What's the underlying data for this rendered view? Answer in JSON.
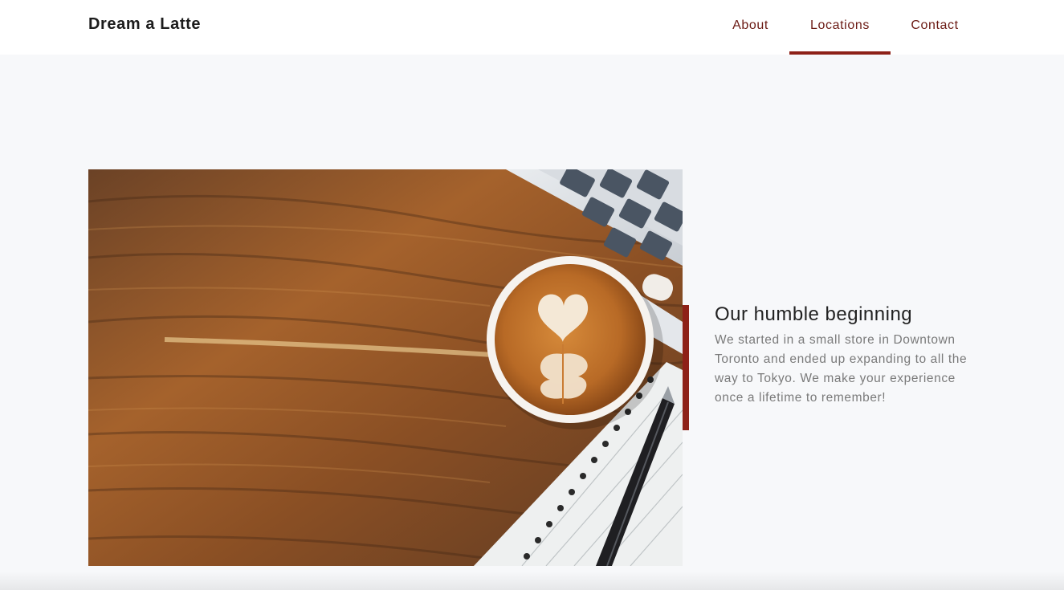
{
  "navbar": {
    "brand": "Dream a Latte",
    "links": [
      {
        "label": "About",
        "active": false
      },
      {
        "label": "Locations",
        "active": true
      },
      {
        "label": "Contact",
        "active": false
      }
    ]
  },
  "main": {
    "image_subject": "latte-art-coffee-on-wooden-desk-with-laptop-and-notebook",
    "heading": "Our humble beginning",
    "paragraph": "We started in a small store in Downtown Toronto and ended up expanding to all the way to Tokyo. We make your experience once a lifetime to remember!"
  },
  "colors": {
    "accent": "#8e2118",
    "nav_text": "#6b1a14",
    "background": "#f7f8fa",
    "navbar_bg": "#ffffff"
  }
}
